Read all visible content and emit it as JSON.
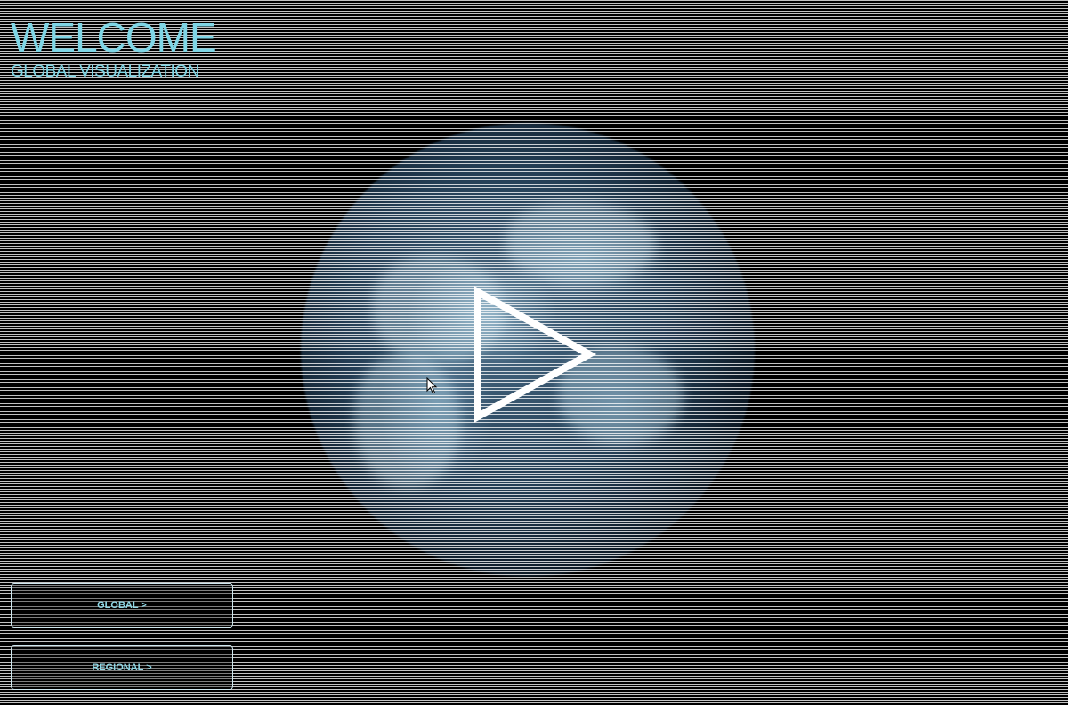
{
  "header": {
    "title": "WELCOME",
    "subtitle": "GLOBAL VISUALIZATION"
  },
  "hero": {
    "play_icon": "play-icon",
    "globe": "globe-image"
  },
  "nav": {
    "global_label": "GLOBAL >",
    "regional_label": "REGIONAL >"
  },
  "colors": {
    "accent": "#7fd6e6",
    "background": "#000000",
    "button_border": "#cfe7ee",
    "play_icon": "#ffffff"
  }
}
